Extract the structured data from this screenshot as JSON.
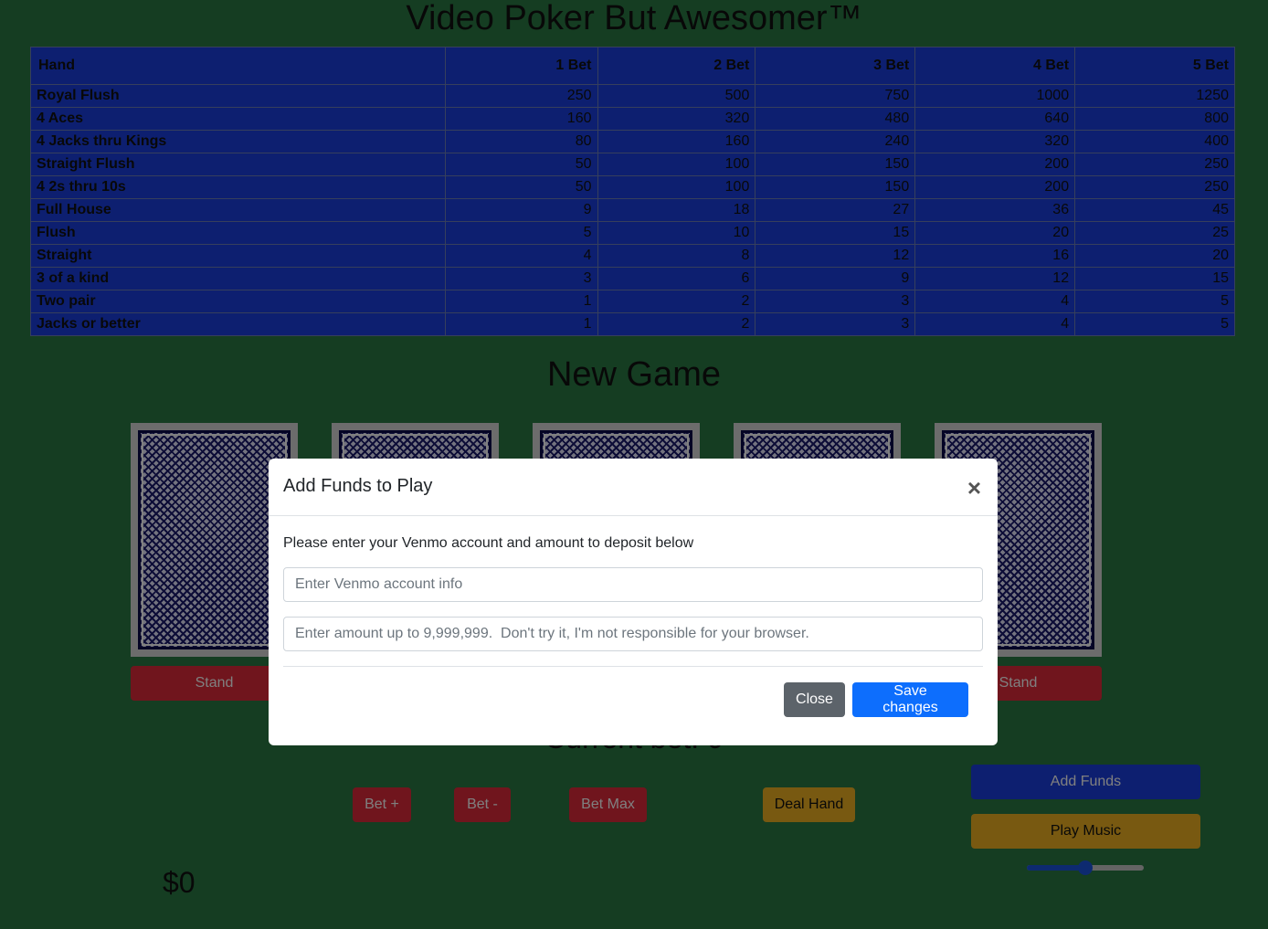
{
  "page": {
    "title": "Video Poker But Awesomer™",
    "section_title": "New Game",
    "current_bet_label": "Current bet: 0",
    "balance": "$0"
  },
  "paytable": {
    "headers": [
      "Hand",
      "1 Bet",
      "2 Bet",
      "3 Bet",
      "4 Bet",
      "5 Bet"
    ],
    "rows": [
      [
        "Royal Flush",
        "250",
        "500",
        "750",
        "1000",
        "1250"
      ],
      [
        "4 Aces",
        "160",
        "320",
        "480",
        "640",
        "800"
      ],
      [
        "4 Jacks thru Kings",
        "80",
        "160",
        "240",
        "320",
        "400"
      ],
      [
        "Straight Flush",
        "50",
        "100",
        "150",
        "200",
        "250"
      ],
      [
        "4 2s thru 10s",
        "50",
        "100",
        "150",
        "200",
        "250"
      ],
      [
        "Full House",
        "9",
        "18",
        "27",
        "36",
        "45"
      ],
      [
        "Flush",
        "5",
        "10",
        "15",
        "20",
        "25"
      ],
      [
        "Straight",
        "4",
        "8",
        "12",
        "16",
        "20"
      ],
      [
        "3 of a kind",
        "3",
        "6",
        "9",
        "12",
        "15"
      ],
      [
        "Two pair",
        "1",
        "2",
        "3",
        "4",
        "5"
      ],
      [
        "Jacks or better",
        "1",
        "2",
        "3",
        "4",
        "5"
      ]
    ]
  },
  "cards": {
    "stand_label": "Stand"
  },
  "controls": {
    "bet_plus": "Bet +",
    "bet_minus": "Bet -",
    "bet_max": "Bet Max",
    "deal_hand": "Deal Hand",
    "add_funds": "Add Funds",
    "play_music": "Play Music",
    "volume": 0.5
  },
  "modal": {
    "title": "Add Funds to Play",
    "close_x": "×",
    "message": "Please enter your Venmo account and amount to deposit below",
    "venmo_placeholder": "Enter Venmo account info",
    "venmo_value": "",
    "amount_placeholder": "Enter amount up to 9,999,999.  Don't try it, I'm not responsible for your browser.",
    "amount_value": "",
    "close_button": "Close",
    "save_button": "Save changes"
  },
  "colors": {
    "background": "#2a7a45",
    "table_blue": "#1b3fe0",
    "button_red": "#e02a3a",
    "button_yellow": "#f0b323",
    "primary": "#0d6efd",
    "secondary": "#5c636a"
  }
}
